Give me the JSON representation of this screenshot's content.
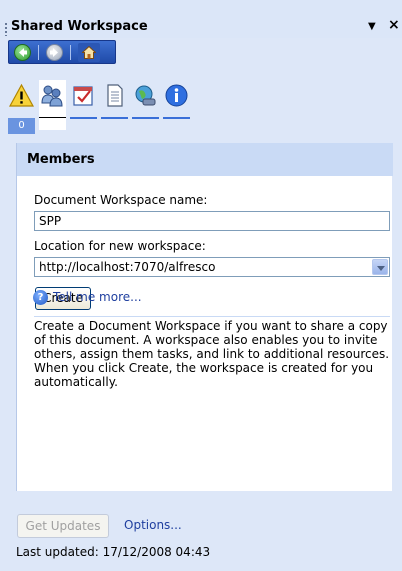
{
  "pane": {
    "title": "Shared Workspace",
    "menu_arrow": "▼",
    "close": "×"
  },
  "nav": {
    "back_icon": "back-arrow-icon",
    "forward_icon": "forward-arrow-icon",
    "home_icon": "home-icon"
  },
  "tabs": [
    {
      "icon": "warning-icon",
      "count": "0"
    },
    {
      "icon": "members-icon",
      "active": true
    },
    {
      "icon": "tasks-icon"
    },
    {
      "icon": "documents-icon"
    },
    {
      "icon": "links-icon"
    },
    {
      "icon": "information-icon"
    }
  ],
  "members": {
    "section_title": "Members",
    "workspace_name_label": "Document Workspace name:",
    "workspace_name_value": "SPP",
    "location_label": "Location for new workspace:",
    "location_value": "http://localhost:7070/alfresco",
    "create_label": "Create",
    "description": "Create a Document Workspace if you want to share a copy of this document.  A workspace also enables you to invite others, assign them tasks, and link to additional resources. When you click Create, the workspace is created for you automatically.",
    "help_link": "Tell me more..."
  },
  "footer": {
    "get_updates_label": "Get Updates",
    "options_label": "Options...",
    "last_updated": "Last updated: 17/12/2008 04:43"
  },
  "colors": {
    "pane_bg": "#dde7f8",
    "section_header_bg": "#c9daf5",
    "link": "#1f3f9f",
    "nav_bar": "#2b57b5"
  }
}
